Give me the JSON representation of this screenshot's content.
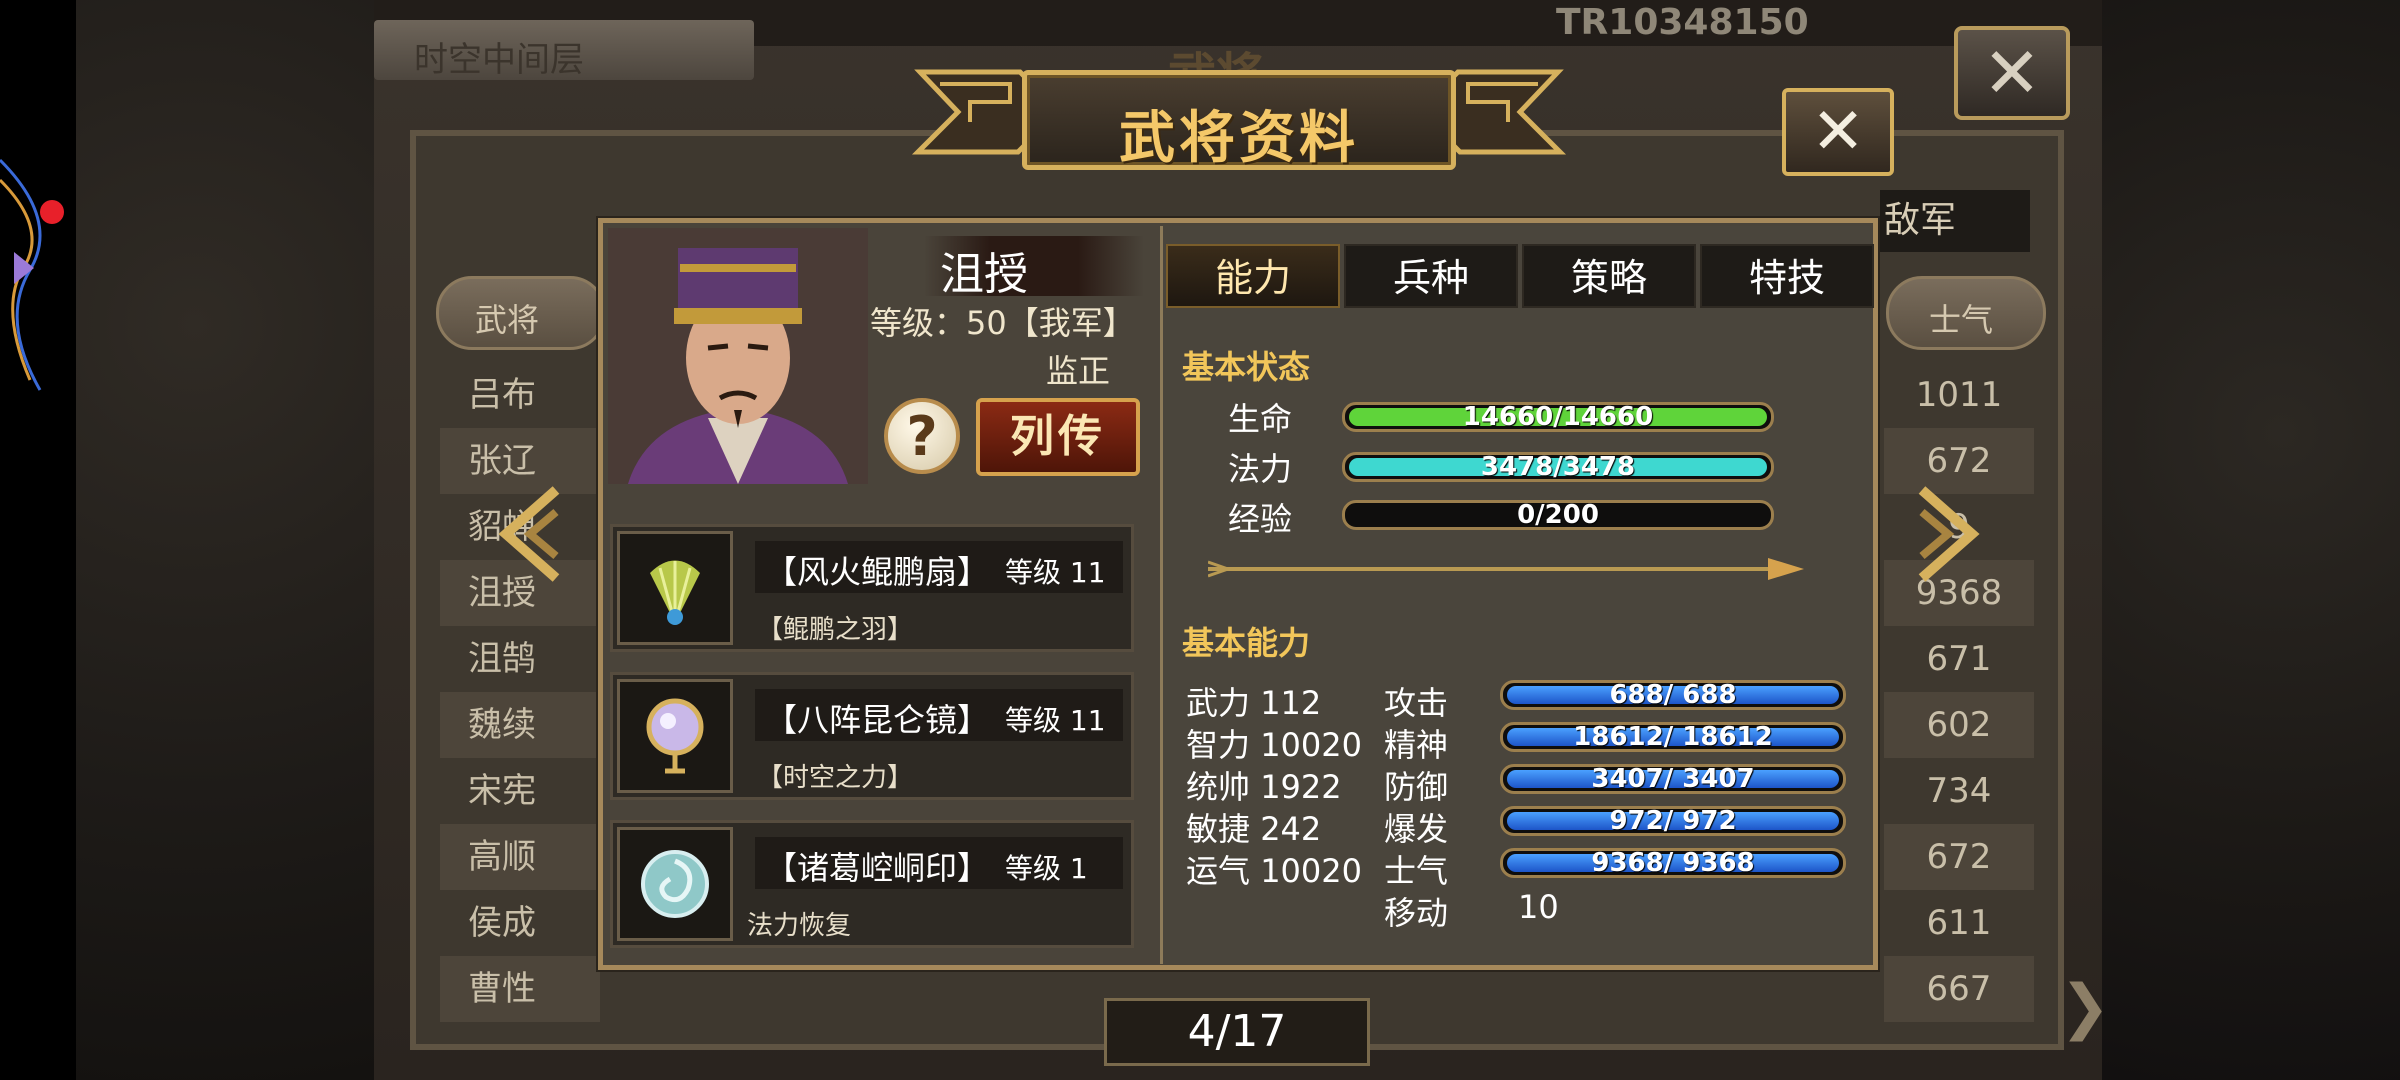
{
  "background": {
    "title_left": "时空中间层",
    "user_id": "TR10348150",
    "banner_title": "武将",
    "enemy_label": "敌军",
    "col_left_header": "武将",
    "col_right_header": "士气",
    "left_names": [
      "吕布",
      "张辽",
      "貂蝉",
      "沮授",
      "沮鹄",
      "魏续",
      "宋宪",
      "高顺",
      "侯成",
      "曹性"
    ],
    "right_values": [
      "1011",
      "672",
      "9",
      "9368",
      "671",
      "602",
      "734",
      "672",
      "611",
      "667"
    ],
    "close_glyph": "✕"
  },
  "modal": {
    "title": "武将资料",
    "close_glyph": "✕",
    "hero": {
      "name": "沮授",
      "level": "等级：50【我军】",
      "job_title": "监正"
    },
    "help_glyph": "?",
    "bio_button": "列传",
    "equipment": [
      {
        "name": "【风火鲲鹏扇】",
        "level": "等级 11",
        "desc": "【鲲鹏之羽】",
        "icon": "feather-fan-icon"
      },
      {
        "name": "【八阵昆仑镜】",
        "level": "等级 11",
        "desc": "【时空之力】",
        "icon": "crystal-mirror-icon"
      },
      {
        "name": "【诸葛崆峒印】",
        "level": "等级 1",
        "desc": "法力恢复",
        "icon": "jade-seal-icon"
      }
    ],
    "tabs": [
      "能力",
      "兵种",
      "策略",
      "特技"
    ],
    "active_tab": 0,
    "basic_status": {
      "title": "基本状态",
      "rows": [
        {
          "label": "生命",
          "text": "14660/14660",
          "fill": 1.0,
          "color": "#5fd43a"
        },
        {
          "label": "法力",
          "text": "3478/3478",
          "fill": 1.0,
          "color": "#3ed8d0"
        },
        {
          "label": "经验",
          "text": "0/200",
          "fill": 0.0,
          "color": "#5fd43a"
        }
      ]
    },
    "basic_ability": {
      "title": "基本能力",
      "attrs": [
        {
          "label": "武力",
          "value": "112"
        },
        {
          "label": "智力",
          "value": "10020"
        },
        {
          "label": "统帅",
          "value": "1922"
        },
        {
          "label": "敏捷",
          "value": "242"
        },
        {
          "label": "运气",
          "value": "10020"
        }
      ],
      "stats": [
        {
          "label": "攻击",
          "text": "688/ 688",
          "fill": 1.0
        },
        {
          "label": "精神",
          "text": "18612/ 18612",
          "fill": 1.0
        },
        {
          "label": "防御",
          "text": "3407/ 3407",
          "fill": 1.0
        },
        {
          "label": "爆发",
          "text": "972/ 972",
          "fill": 1.0
        },
        {
          "label": "士气",
          "text": "9368/ 9368",
          "fill": 1.0
        }
      ],
      "move_label": "移动",
      "move_value": "10"
    },
    "pager": "4/17"
  }
}
